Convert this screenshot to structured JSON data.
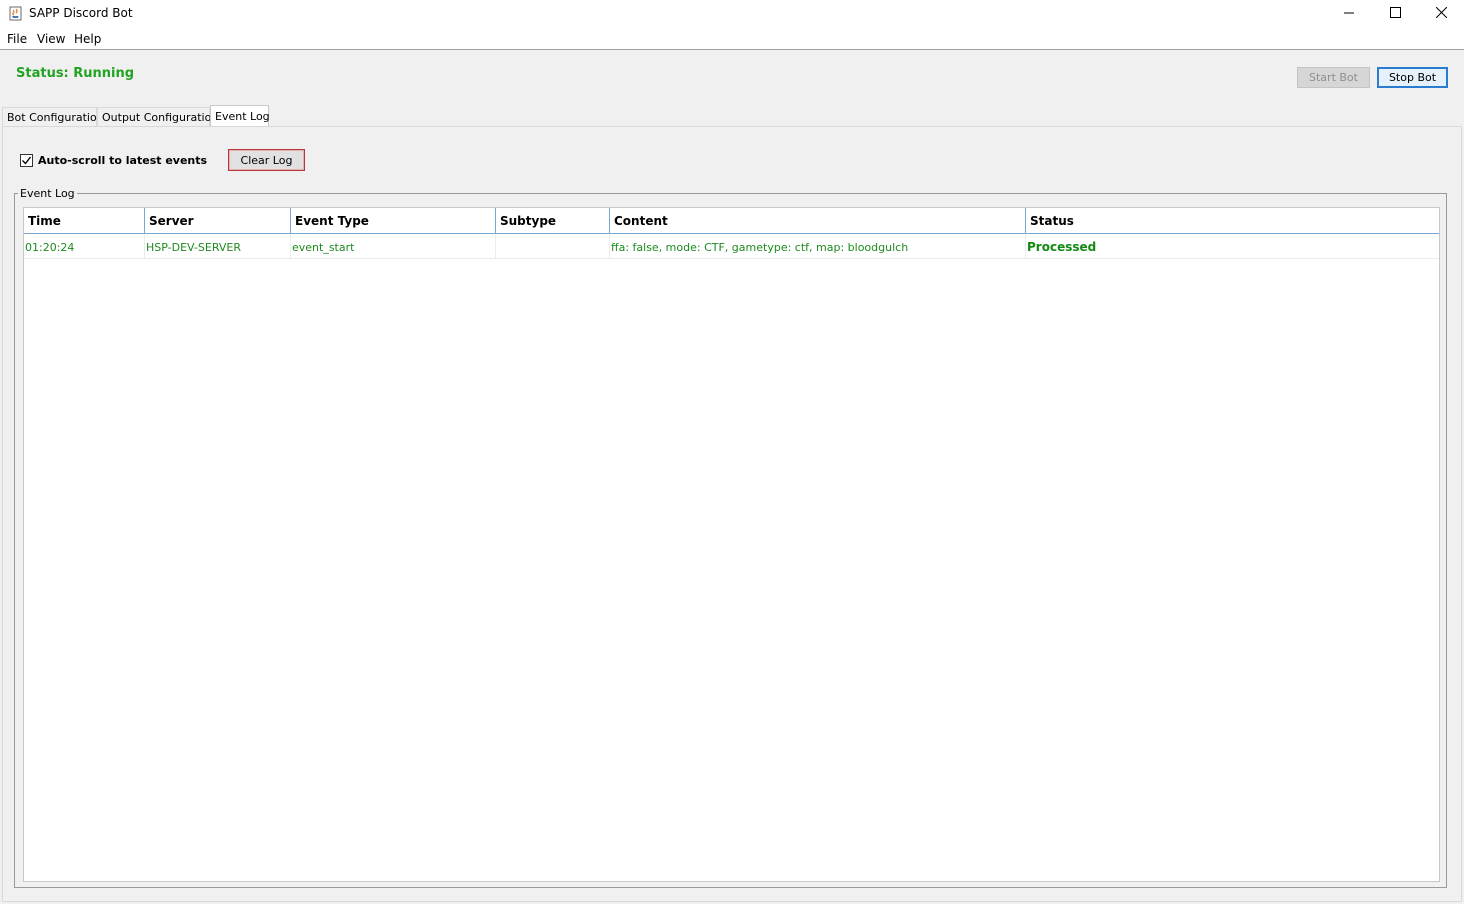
{
  "window": {
    "title": "SAPP Discord Bot",
    "icon": "java-cup-icon"
  },
  "menu": {
    "items": [
      "File",
      "View",
      "Help"
    ]
  },
  "status": {
    "text": "Status: Running",
    "color": "#22a322"
  },
  "toolbar": {
    "start_label": "Start Bot",
    "start_enabled": false,
    "stop_label": "Stop Bot"
  },
  "tabs": {
    "items": [
      "Bot Configuration",
      "Output Configuration",
      "Event Log"
    ],
    "active": "Event Log"
  },
  "event_log": {
    "autoscroll_label": "Auto-scroll to latest events",
    "autoscroll_checked": true,
    "clear_label": "Clear Log",
    "group_title": "Event Log",
    "columns": [
      "Time",
      "Server",
      "Event Type",
      "Subtype",
      "Content",
      "Status"
    ],
    "rows": [
      {
        "time": "01:20:24",
        "server": "HSP-DEV-SERVER",
        "event_type": "event_start",
        "subtype": "",
        "content": "ffa: false, mode: CTF, gametype: ctf, map: bloodgulch",
        "status": "Processed"
      }
    ],
    "row_color": "#1f8a1f",
    "status_color": "#128a12"
  }
}
